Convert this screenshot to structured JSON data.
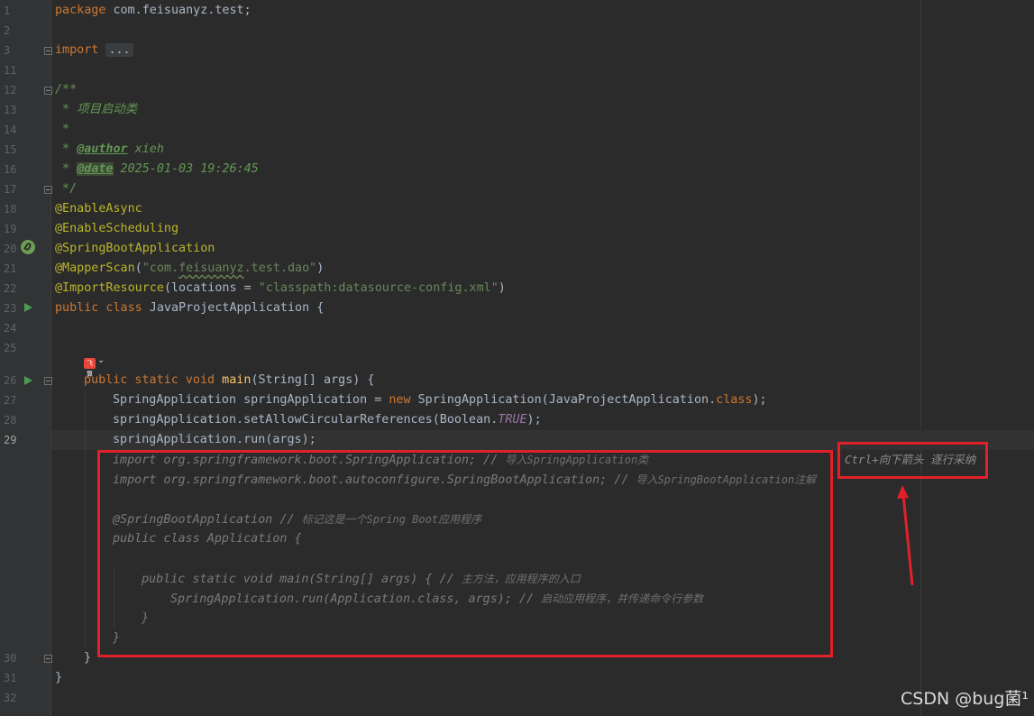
{
  "editor": {
    "line_numbers": [
      "1",
      "2",
      "3",
      "11",
      "12",
      "13",
      "14",
      "15",
      "16",
      "17",
      "18",
      "19",
      "20",
      "21",
      "22",
      "23",
      "24",
      "25",
      "26",
      "27",
      "28",
      "29",
      "30",
      "31",
      "32"
    ],
    "code": {
      "package_kw": "package",
      "package_name": " com.feisuanyz.test;",
      "import_kw": "import",
      "import_folded": "...",
      "doc_open": "/**",
      "doc_line1": " * 项目启动类",
      "doc_line2": " *",
      "doc_author_prefix": " * ",
      "doc_author_tag": "@author",
      "doc_author_value": " xieh",
      "doc_date_prefix": " * ",
      "doc_date_tag": "@date",
      "doc_date_value": " 2025-01-03 19:26:45",
      "doc_close": " */",
      "ann_async": "@EnableAsync",
      "ann_scheduling": "@EnableScheduling",
      "ann_springboot": "@SpringBootApplication",
      "ann_mapperscan": "@MapperScan",
      "mapperscan_open": "(",
      "mapperscan_str_a": "\"com.",
      "mapperscan_str_b": "feisuanyz",
      "mapperscan_str_c": ".test.dao\"",
      "mapperscan_close": ")",
      "ann_importresource": "@ImportResource",
      "importresource_mid": "(locations = ",
      "importresource_str": "\"classpath:datasource-config.xml\"",
      "importresource_close": ")",
      "class_public": "public",
      "class_class": " class",
      "class_name": " JavaProjectApplication {",
      "main_public": "public",
      "main_static": " static",
      "main_void": " void",
      "main_name": " main",
      "main_params": "(String[] args) {",
      "l27_a": "SpringApplication springApplication = ",
      "l27_new": "new",
      "l27_b": " SpringApplication(JavaProjectApplication.",
      "l27_class": "class",
      "l27_c": ");",
      "l28_a": "springApplication.setAllowCircularReferences(Boolean.",
      "l28_true": "TRUE",
      "l28_b": ");",
      "l29": "springApplication.run(args);",
      "close_method": "}",
      "close_class": "}"
    },
    "suggestion": {
      "line1_code": "import org.springframework.boot.SpringApplication; // ",
      "line1_cn": "导入SpringApplication类",
      "line2_code": "import org.springframework.boot.autoconfigure.SpringBootApplication; // ",
      "line2_cn": "导入SpringBootApplication注解",
      "line3_code": "@SpringBootApplication // ",
      "line3_cn": "标记这是一个Spring Boot应用程序",
      "line4_code": "public class Application {",
      "line5_code": "public static void main(String[] args) { // ",
      "line5_cn": "主方法，应用程序的入口",
      "line6_code": "SpringApplication.run(Application.class, args); // ",
      "line6_cn": "启动应用程序，并传递命令行参数",
      "line7_code": "}",
      "line8_code": "}"
    },
    "feishu_badge": "飞算",
    "feishu_chevron": "⌄",
    "hint": "Ctrl+向下箭头 逐行采纳"
  },
  "watermark": "CSDN @bug菌¹",
  "colors": {
    "annotation_box": "#e0212a",
    "background": "#2b2b2b",
    "gutter": "#313335"
  }
}
